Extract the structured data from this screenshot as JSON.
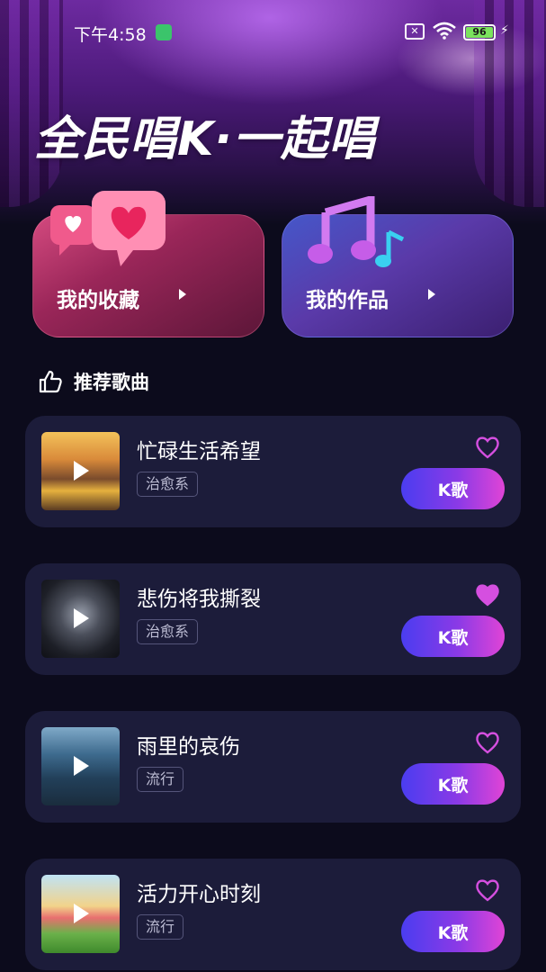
{
  "status_bar": {
    "time": "下午4:58",
    "battery_level": "96"
  },
  "header": {
    "title": "全民唱K·一起唱"
  },
  "quick_cards": {
    "favorites_label": "我的收藏",
    "works_label": "我的作品"
  },
  "section": {
    "label": "推荐歌曲",
    "icon": "thumbs-up-icon"
  },
  "songs": [
    {
      "title": "忙碌生活希望",
      "tag": "治愈系",
      "liked": false,
      "button": "K歌"
    },
    {
      "title": "悲伤将我撕裂",
      "tag": "治愈系",
      "liked": true,
      "button": "K歌"
    },
    {
      "title": "雨里的哀伤",
      "tag": "流行",
      "liked": false,
      "button": "K歌"
    },
    {
      "title": "活力开心时刻",
      "tag": "流行",
      "liked": false,
      "button": "K歌"
    }
  ],
  "colors": {
    "background": "#0c0b1c",
    "card": "#1c1c3a",
    "accent_pink": "#e044d6",
    "accent_blue": "#4a3df0",
    "heart": "#d54fe0"
  }
}
